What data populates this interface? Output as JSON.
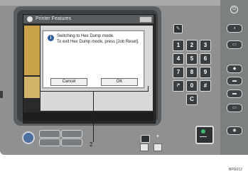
{
  "screen": {
    "title": "Printer Features"
  },
  "dialog": {
    "message_line1": "Switching to Hex Dump mode.",
    "message_line2": "To exit Hex Dump mode, press [Job Reset].",
    "cancel_label": "Cancel",
    "ok_label": "OK",
    "info_icon": "i"
  },
  "callout": {
    "number": "2"
  },
  "keypad": {
    "keys": [
      "1",
      "2",
      "3",
      "4",
      "5",
      "6",
      "7",
      "8",
      "9",
      "/*",
      "0",
      "#",
      "C"
    ]
  },
  "figure_code": "BPG012"
}
